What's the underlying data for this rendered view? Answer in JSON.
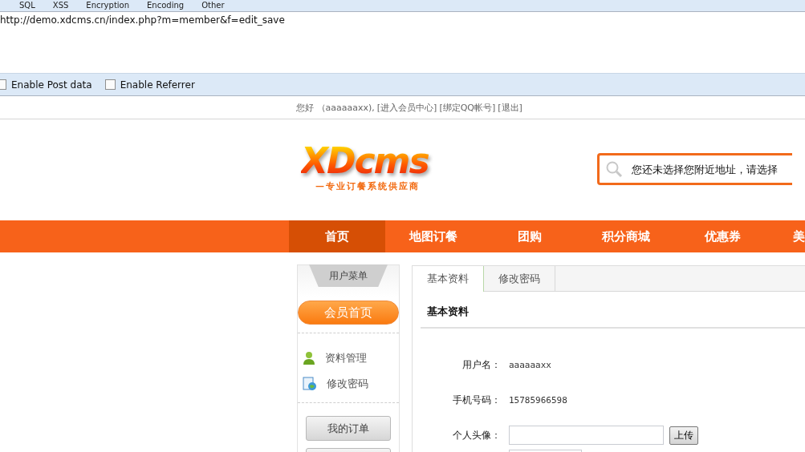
{
  "toolbar": {
    "menus": [
      "SQL",
      "XSS",
      "Encryption",
      "Encoding",
      "Other"
    ]
  },
  "url_box": {
    "value": "http://demo.xdcms.cn/index.php?m=member&f=edit_save"
  },
  "options": [
    {
      "label": "Enable Post data",
      "checked": false
    },
    {
      "label": "Enable Referrer",
      "checked": false
    }
  ],
  "top_bar": {
    "greeting": "您好 （aaaaaaxx),",
    "links": [
      "[进入会员中心]",
      "[绑定QQ帐号]",
      "[退出]"
    ]
  },
  "logo": {
    "title": "XDcms",
    "tagline": "—专业订餐系统供应商"
  },
  "search": {
    "placeholder": "您还未选择您附近地址，请选择"
  },
  "nav": [
    {
      "label": "首页",
      "selected": true
    },
    {
      "label": "地图订餐",
      "selected": false
    },
    {
      "label": "团购",
      "selected": false
    },
    {
      "label": "积分商城",
      "selected": false
    },
    {
      "label": "优惠券",
      "selected": false
    },
    {
      "label": "美",
      "selected": false
    }
  ],
  "sidebar": {
    "title": "用户菜单",
    "home_button": "会员首页",
    "items": [
      {
        "label": "资料管理"
      },
      {
        "label": "修改密码"
      }
    ],
    "buttons": [
      "我的订单"
    ]
  },
  "main": {
    "tabs": [
      {
        "label": "基本资料",
        "selected": true
      },
      {
        "label": "修改密码",
        "selected": false
      }
    ],
    "section_title": "基本资料",
    "fields": [
      {
        "kind": "text",
        "label": "用户名：",
        "value": "aaaaaaxx"
      },
      {
        "kind": "text",
        "label": "手机号码：",
        "value": "15785966598"
      },
      {
        "kind": "upload",
        "label": "个人头像：",
        "button": "上传"
      }
    ]
  }
}
